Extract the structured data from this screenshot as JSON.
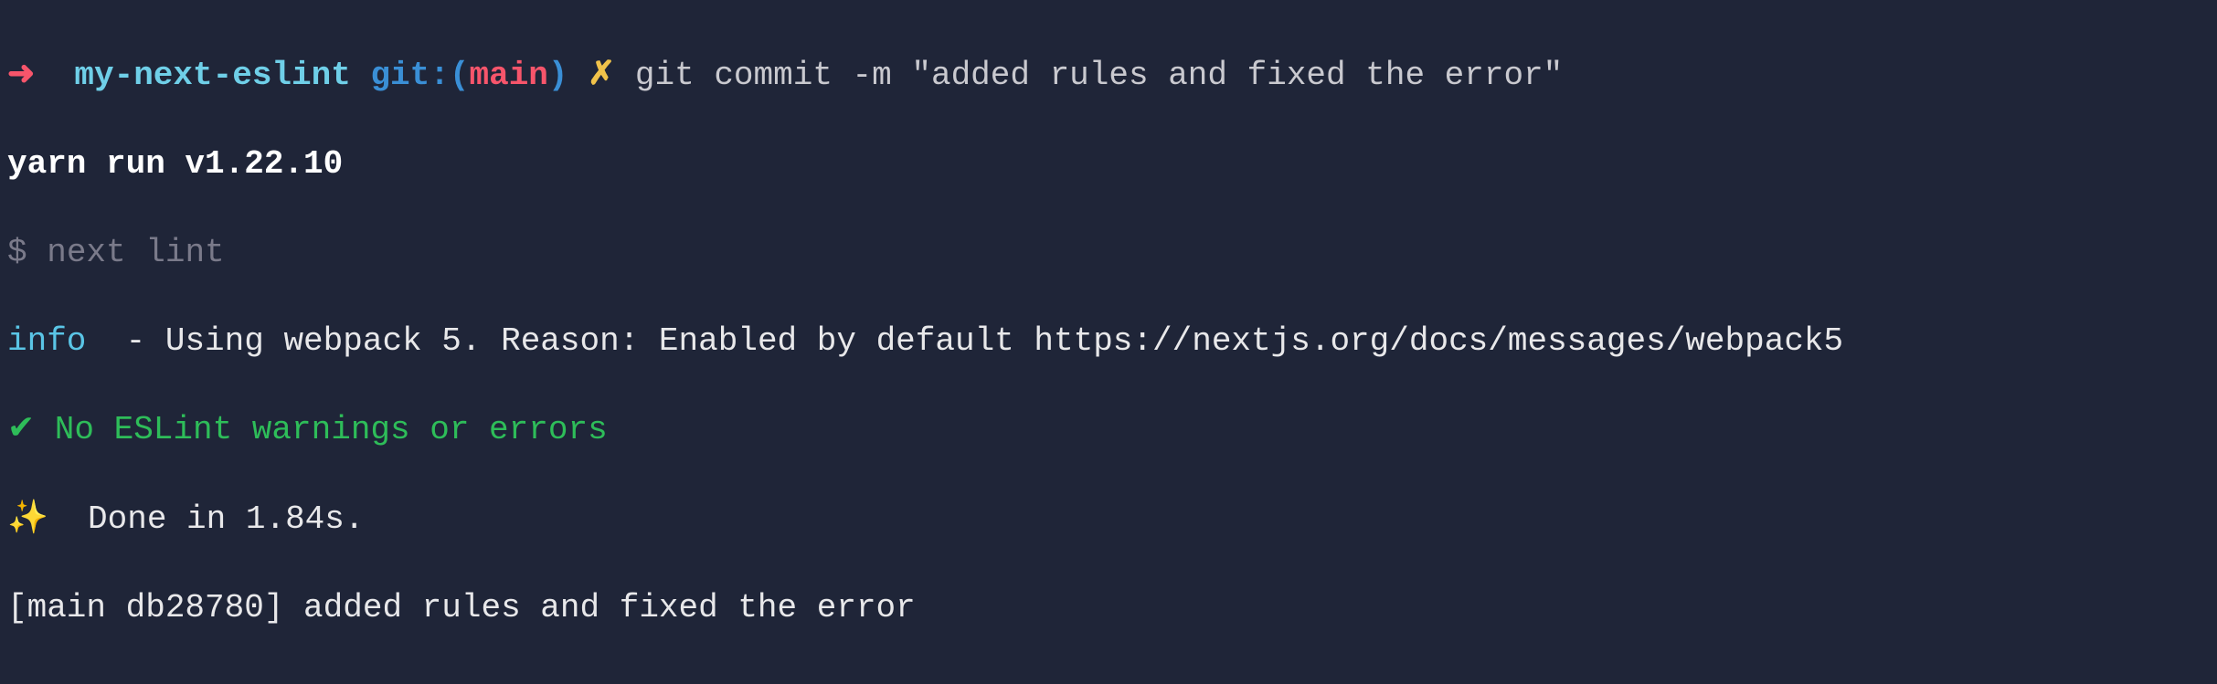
{
  "prompt": {
    "arrow": "➜",
    "project": "my-next-eslint",
    "git_label": "git:",
    "paren_open": "(",
    "branch": "main",
    "paren_close": ")",
    "dirty_mark": "✗",
    "command": "git commit -m \"added rules and fixed the error\""
  },
  "yarn_run": "yarn run v1.22.10",
  "subcmd_prefix": "$ ",
  "subcmd": "next lint",
  "info_label": "info",
  "info_text": "  - Using webpack 5. Reason: Enabled by default https://nextjs.org/docs/messages/webpack5",
  "eslint_check": "✔",
  "eslint_text": " No ESLint warnings or errors",
  "done_sparkle": "✨",
  "done_text": "  Done in 1.84s.",
  "commit_result": "[main db28780] added rules and fixed the error"
}
